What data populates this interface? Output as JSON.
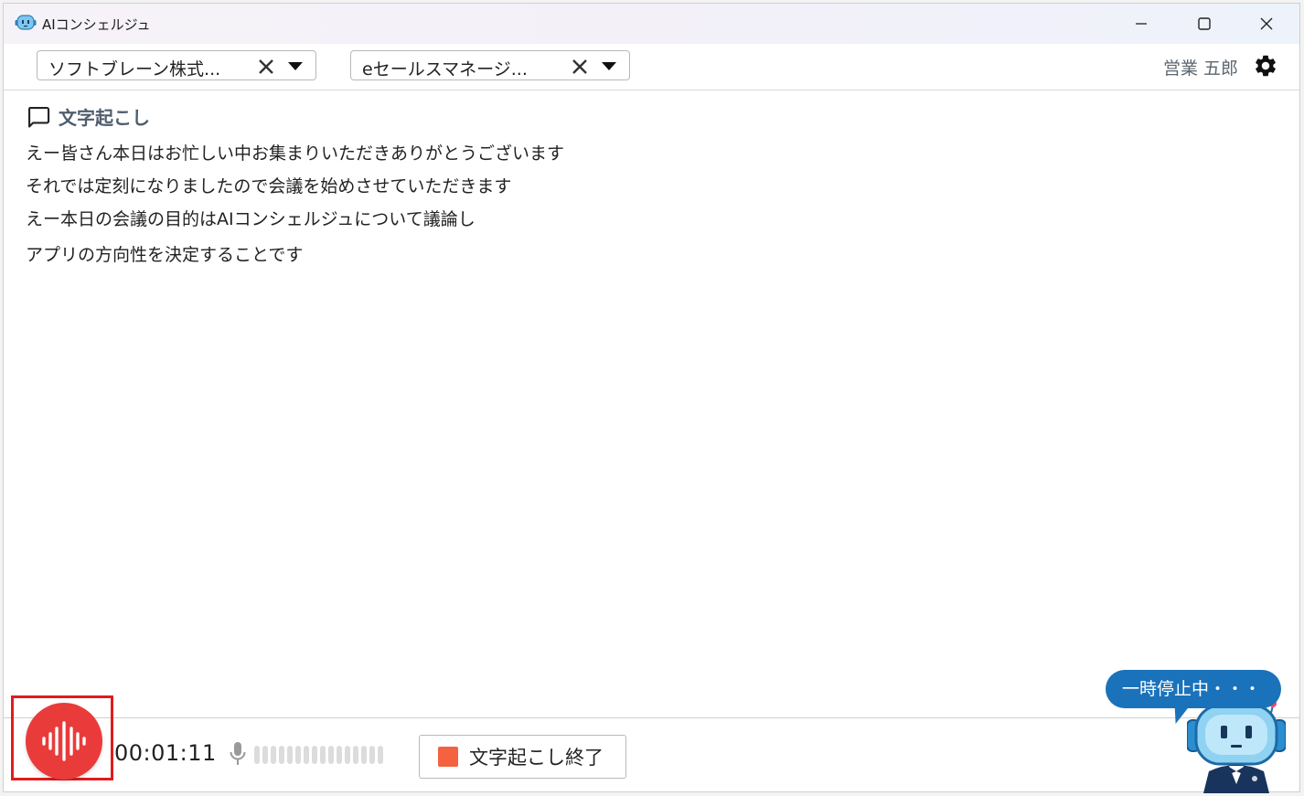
{
  "window": {
    "title": "AIコンシェルジュ",
    "icons": {
      "app": "robot-app-icon",
      "minimize": "minimize-icon",
      "maximize": "maximize-icon",
      "close": "close-icon"
    }
  },
  "toolbar": {
    "company_select": {
      "value": "ソフトブレーン株式..."
    },
    "product_select": {
      "value": "eセールスマネージ..."
    },
    "user_name": "営業 五郎",
    "icons": {
      "clear": "clear-x-icon",
      "dropdown": "caret-down-icon",
      "settings": "gear-icon"
    }
  },
  "transcript": {
    "title": "文字起こし",
    "icon": "chat-bubble-icon",
    "lines": [
      "えー皆さん本日はお忙しい中お集まりいただきありがとうございます",
      "それでは定刻になりましたので会議を始めさせていただきます",
      "えー本日の会議の目的はAIコンシェルジュについて議論し",
      "アプリの方向性を決定することです"
    ]
  },
  "bottombar": {
    "timer": "00:01:11",
    "stop_button_label": "文字起こし終了",
    "status_bubble": "一時停止中・・・",
    "icons": {
      "record": "audio-waveform-icon",
      "mic": "microphone-icon",
      "mascot": "robot-mascot"
    }
  },
  "colors": {
    "record_red": "#ea3b3b",
    "highlight_border": "#e11b1b",
    "stop_square": "#f4623f",
    "bubble_blue": "#1a72bb",
    "section_title": "#4f5d6e"
  }
}
